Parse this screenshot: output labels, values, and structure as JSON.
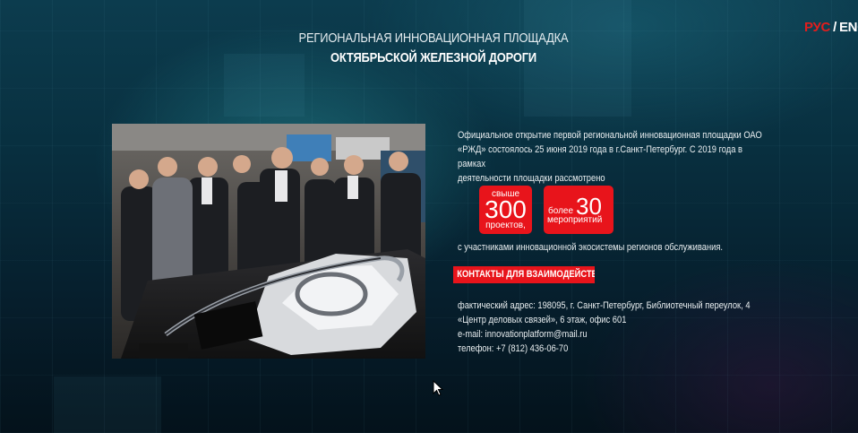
{
  "header": {
    "title_line1": "РЕГИОНАЛЬНАЯ ИННОВАЦИОННАЯ ПЛОЩАДКА",
    "title_line2": "ОКТЯБРЬСКОЙ ЖЕЛЕЗНОЙ ДОРОГИ"
  },
  "language_switch": {
    "ru": "РУС",
    "separator": "/",
    "en": "ENG",
    "active": "ru",
    "active_color": "#e21d1d"
  },
  "intro_text": {
    "line1": "Официальное открытие первой региональной инновационная площадки ОАО",
    "line2": "«РЖД» состоялось 25 июня 2019 года в г.Санкт-Петербург. С 2019 года в рамках",
    "line3": "деятельности площадки рассмотрено"
  },
  "stats": [
    {
      "top": "свыше",
      "number": "300",
      "bottom": "проектов,"
    },
    {
      "top": "более",
      "number": "30",
      "bottom": "мероприятий"
    }
  ],
  "ecosystem_text": "с участниками инновационной экосистемы регионов обслуживания.",
  "contacts": {
    "header": "КОНТАКТЫ ДЛЯ ВЗАИМОДЕЙСТВИЯ:",
    "address_line1": "фактический адрес: 198095, г. Санкт-Петербург, Библиотечный переулок, 4",
    "address_line2": "«Центр деловых связей», 6 этаж, офис 601",
    "email": "e-mail: innovationplatform@mail.ru",
    "phone": "телефон: +7 (812) 436-06-70"
  },
  "colors": {
    "accent": "#e8141b",
    "background_top": "#0c3c4e",
    "background_bottom": "#04121b",
    "text": "#e9eef0"
  }
}
